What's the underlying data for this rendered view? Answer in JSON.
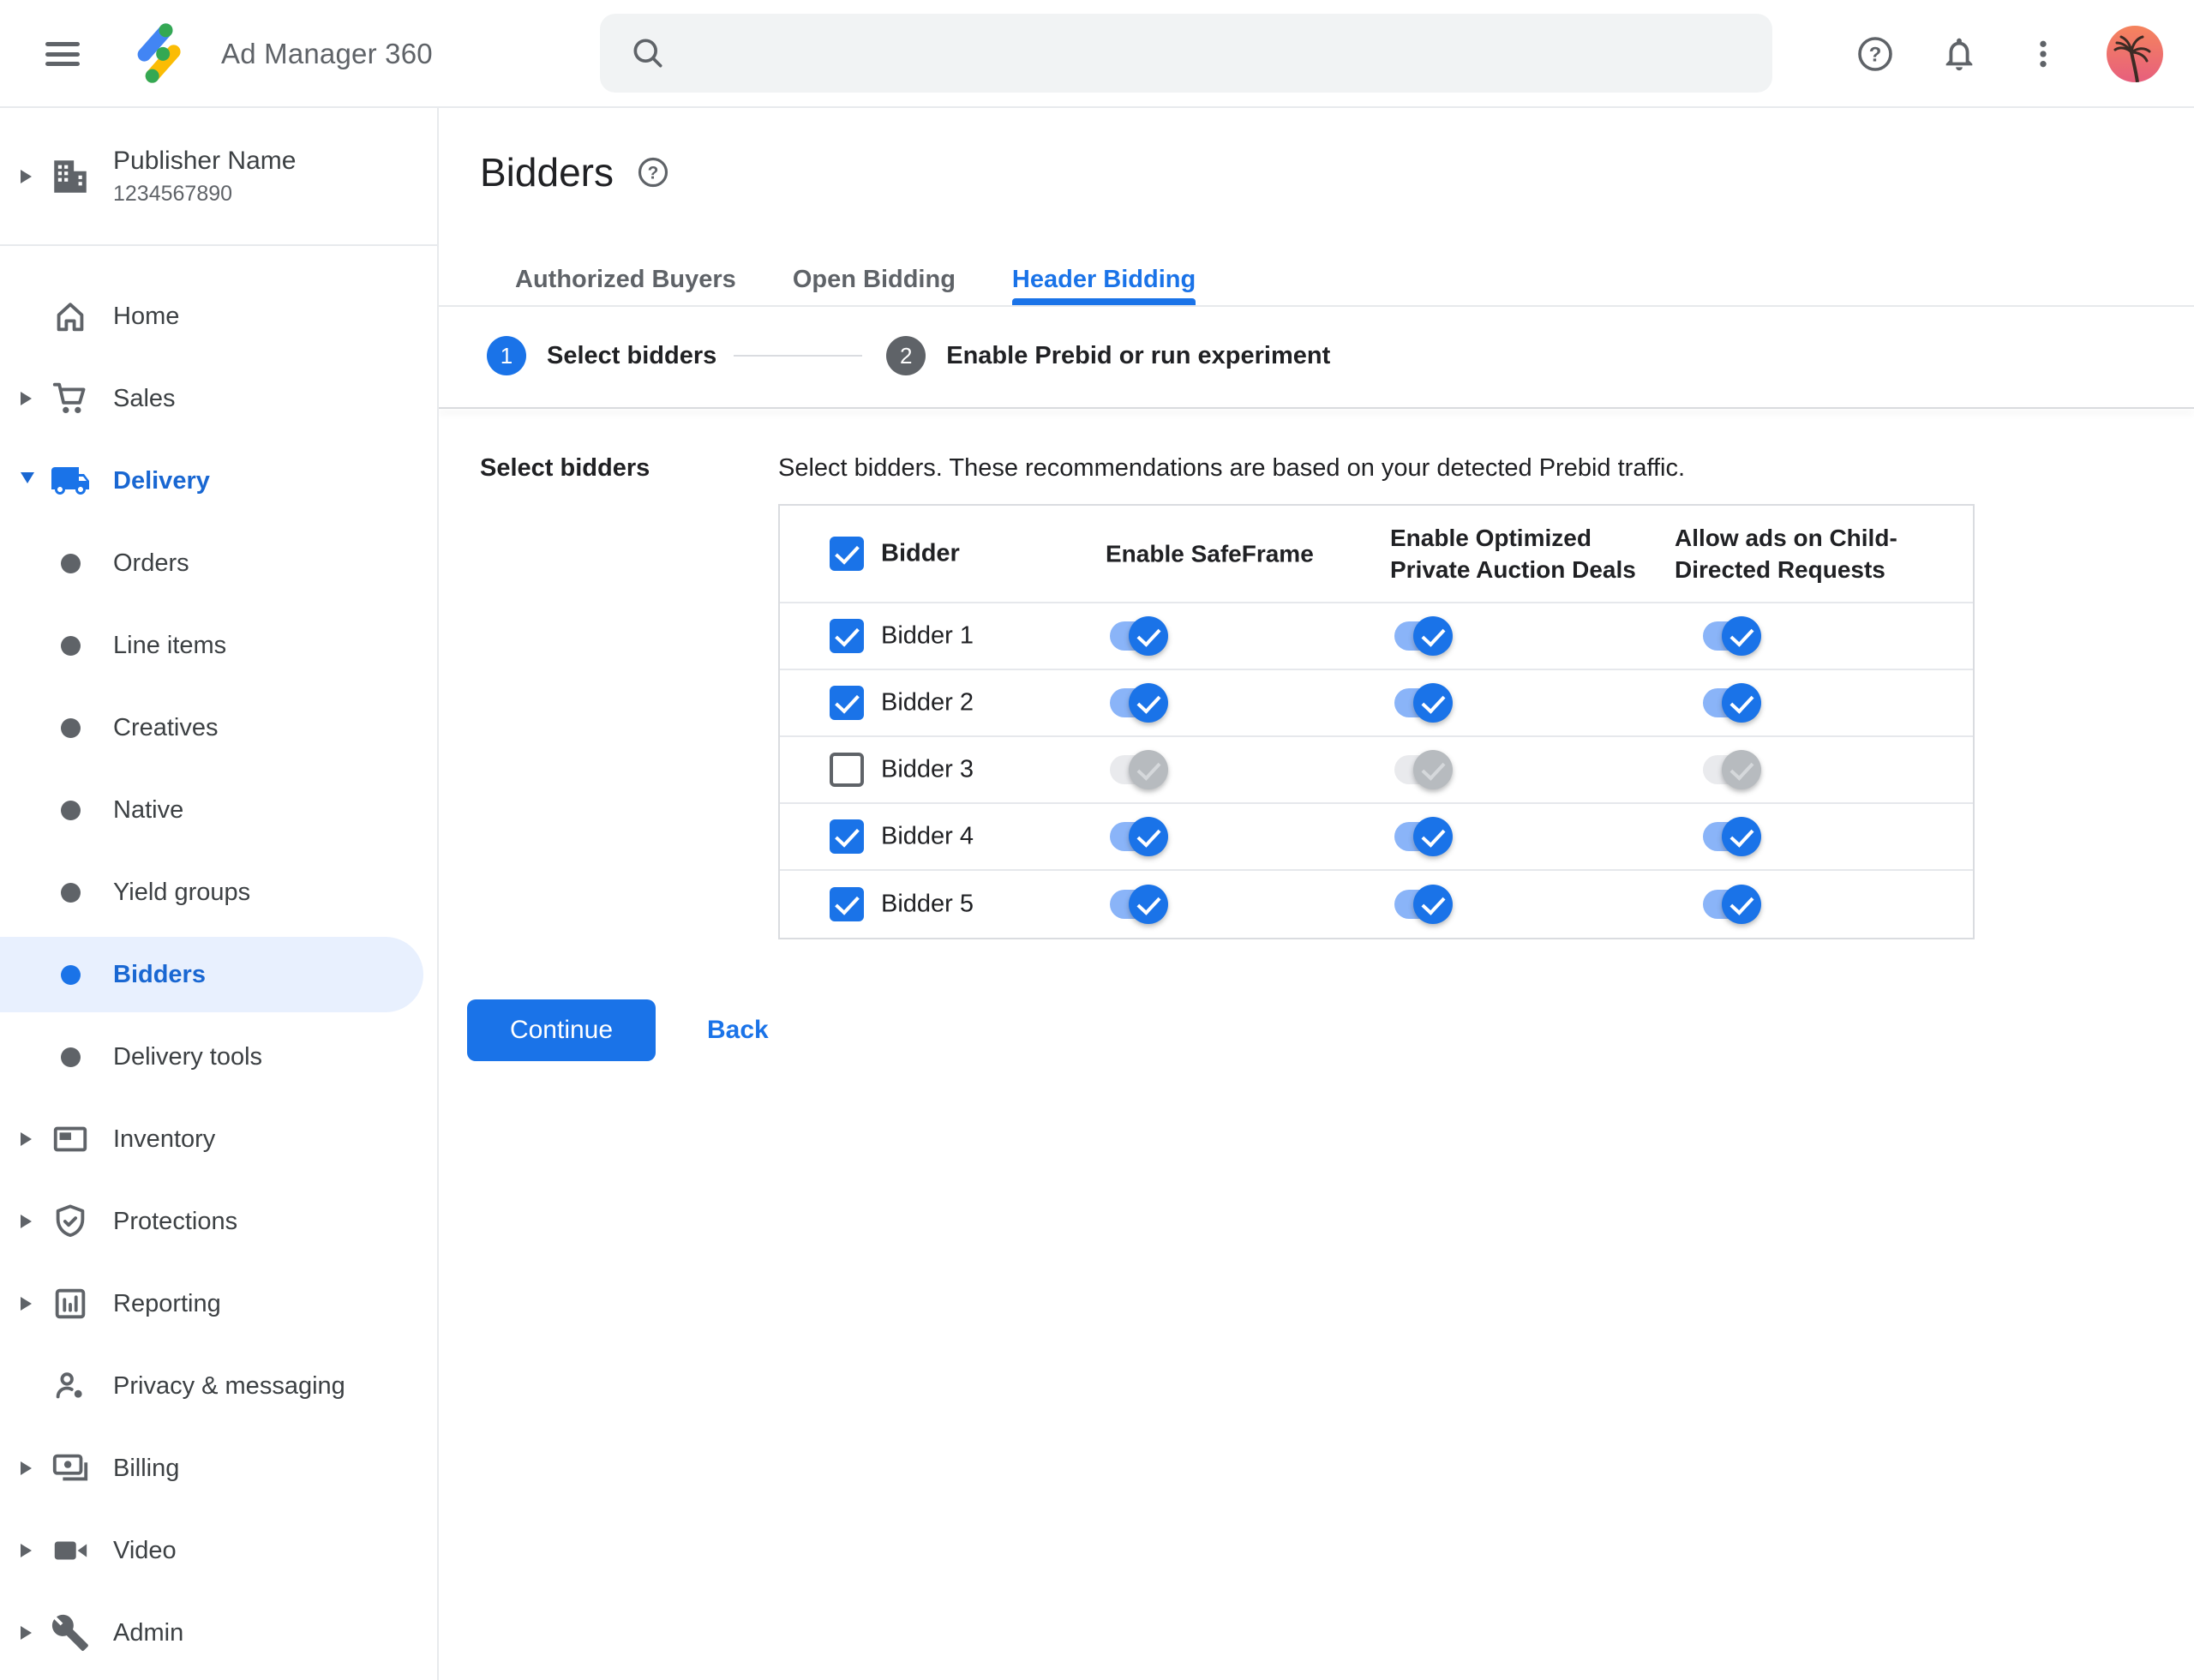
{
  "topbar": {
    "product": "Ad Manager 360",
    "search": {
      "value": "",
      "placeholder": ""
    },
    "icons": [
      "menu-icon",
      "search-icon",
      "help-icon",
      "notifications-icon",
      "more-icon",
      "avatar"
    ]
  },
  "sidebar": {
    "publisher": {
      "name": "Publisher Name",
      "id": "1234567890"
    },
    "items": [
      {
        "label": "Home"
      },
      {
        "label": "Sales",
        "collapsible": true
      },
      {
        "label": "Delivery",
        "collapsible": true,
        "expanded": true
      },
      {
        "label": "Orders",
        "child": true
      },
      {
        "label": "Line items",
        "child": true
      },
      {
        "label": "Creatives",
        "child": true
      },
      {
        "label": "Native",
        "child": true
      },
      {
        "label": "Yield groups",
        "child": true
      },
      {
        "label": "Bidders",
        "child": true,
        "selected": true
      },
      {
        "label": "Delivery tools",
        "child": true
      },
      {
        "label": "Inventory",
        "collapsible": true
      },
      {
        "label": "Protections",
        "collapsible": true
      },
      {
        "label": "Reporting",
        "collapsible": true
      },
      {
        "label": "Privacy & messaging"
      },
      {
        "label": "Billing",
        "collapsible": true
      },
      {
        "label": "Video",
        "collapsible": true
      },
      {
        "label": "Admin",
        "collapsible": true
      }
    ]
  },
  "page": {
    "title": "Bidders"
  },
  "tabs": [
    {
      "label": "Authorized Buyers",
      "active": false
    },
    {
      "label": "Open Bidding",
      "active": false
    },
    {
      "label": "Header Bidding",
      "active": true
    }
  ],
  "stepper": {
    "steps": [
      {
        "number": "1",
        "label": "Select bidders",
        "active": true
      },
      {
        "number": "2",
        "label": "Enable Prebid or run experiment",
        "active": false
      }
    ]
  },
  "panel": {
    "side_label": "Select bidders",
    "description": "Select bidders. These recommendations are based on your detected Prebid traffic."
  },
  "table": {
    "header_checked": true,
    "headers": {
      "bidder": "Bidder",
      "safeframe": "Enable SafeFrame",
      "optimized": "Enable Optimized Private Auction Deals",
      "child": "Allow ads on Child-Directed Requests"
    },
    "rows": [
      {
        "label": "Bidder 1",
        "checked": true,
        "safeframe": true,
        "optimized": true,
        "child": true
      },
      {
        "label": "Bidder 2",
        "checked": true,
        "safeframe": true,
        "optimized": true,
        "child": true
      },
      {
        "label": "Bidder 3",
        "checked": false,
        "safeframe": false,
        "optimized": false,
        "child": false
      },
      {
        "label": "Bidder 4",
        "checked": true,
        "safeframe": true,
        "optimized": true,
        "child": true
      },
      {
        "label": "Bidder 5",
        "checked": true,
        "safeframe": true,
        "optimized": true,
        "child": true
      }
    ]
  },
  "actions": {
    "continue_label": "Continue",
    "back_label": "Back"
  },
  "colors": {
    "accent": "#1a73e8",
    "nav_active": "#1967d2",
    "nav_highlight": "#e8f0fe",
    "toggle_track_on": "#8ab4f8",
    "toggle_track_off": "#e9eaed",
    "text_primary": "#202124",
    "text_secondary": "#5f6368",
    "border": "#dadce0",
    "search_bg": "#f1f3f4"
  }
}
